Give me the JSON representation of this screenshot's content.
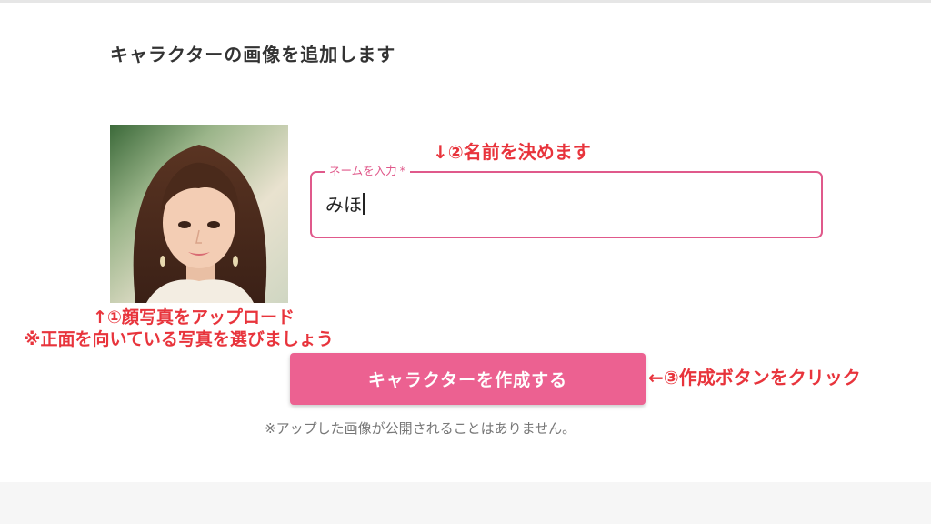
{
  "page": {
    "title": "キャラクターの画像を追加します"
  },
  "name_field": {
    "label": "ネームを入力",
    "required_mark": "*",
    "value": "みほ"
  },
  "create_button": {
    "label": "キャラクターを作成する"
  },
  "privacy_note": "※アップした画像が公開されることはありません。",
  "annotations": {
    "name_hint": "↓②名前を決めます",
    "photo_hint_1": "↑①顔写真をアップロード",
    "photo_hint_2": "※正面を向いている写真を選びましょう",
    "create_hint": "←③作成ボタンをクリック"
  },
  "colors": {
    "accent": "#ec6191",
    "field_border": "#e0598b",
    "annotation_red": "#e8343c"
  },
  "icons": {
    "uploaded_photo": "face-photo"
  }
}
